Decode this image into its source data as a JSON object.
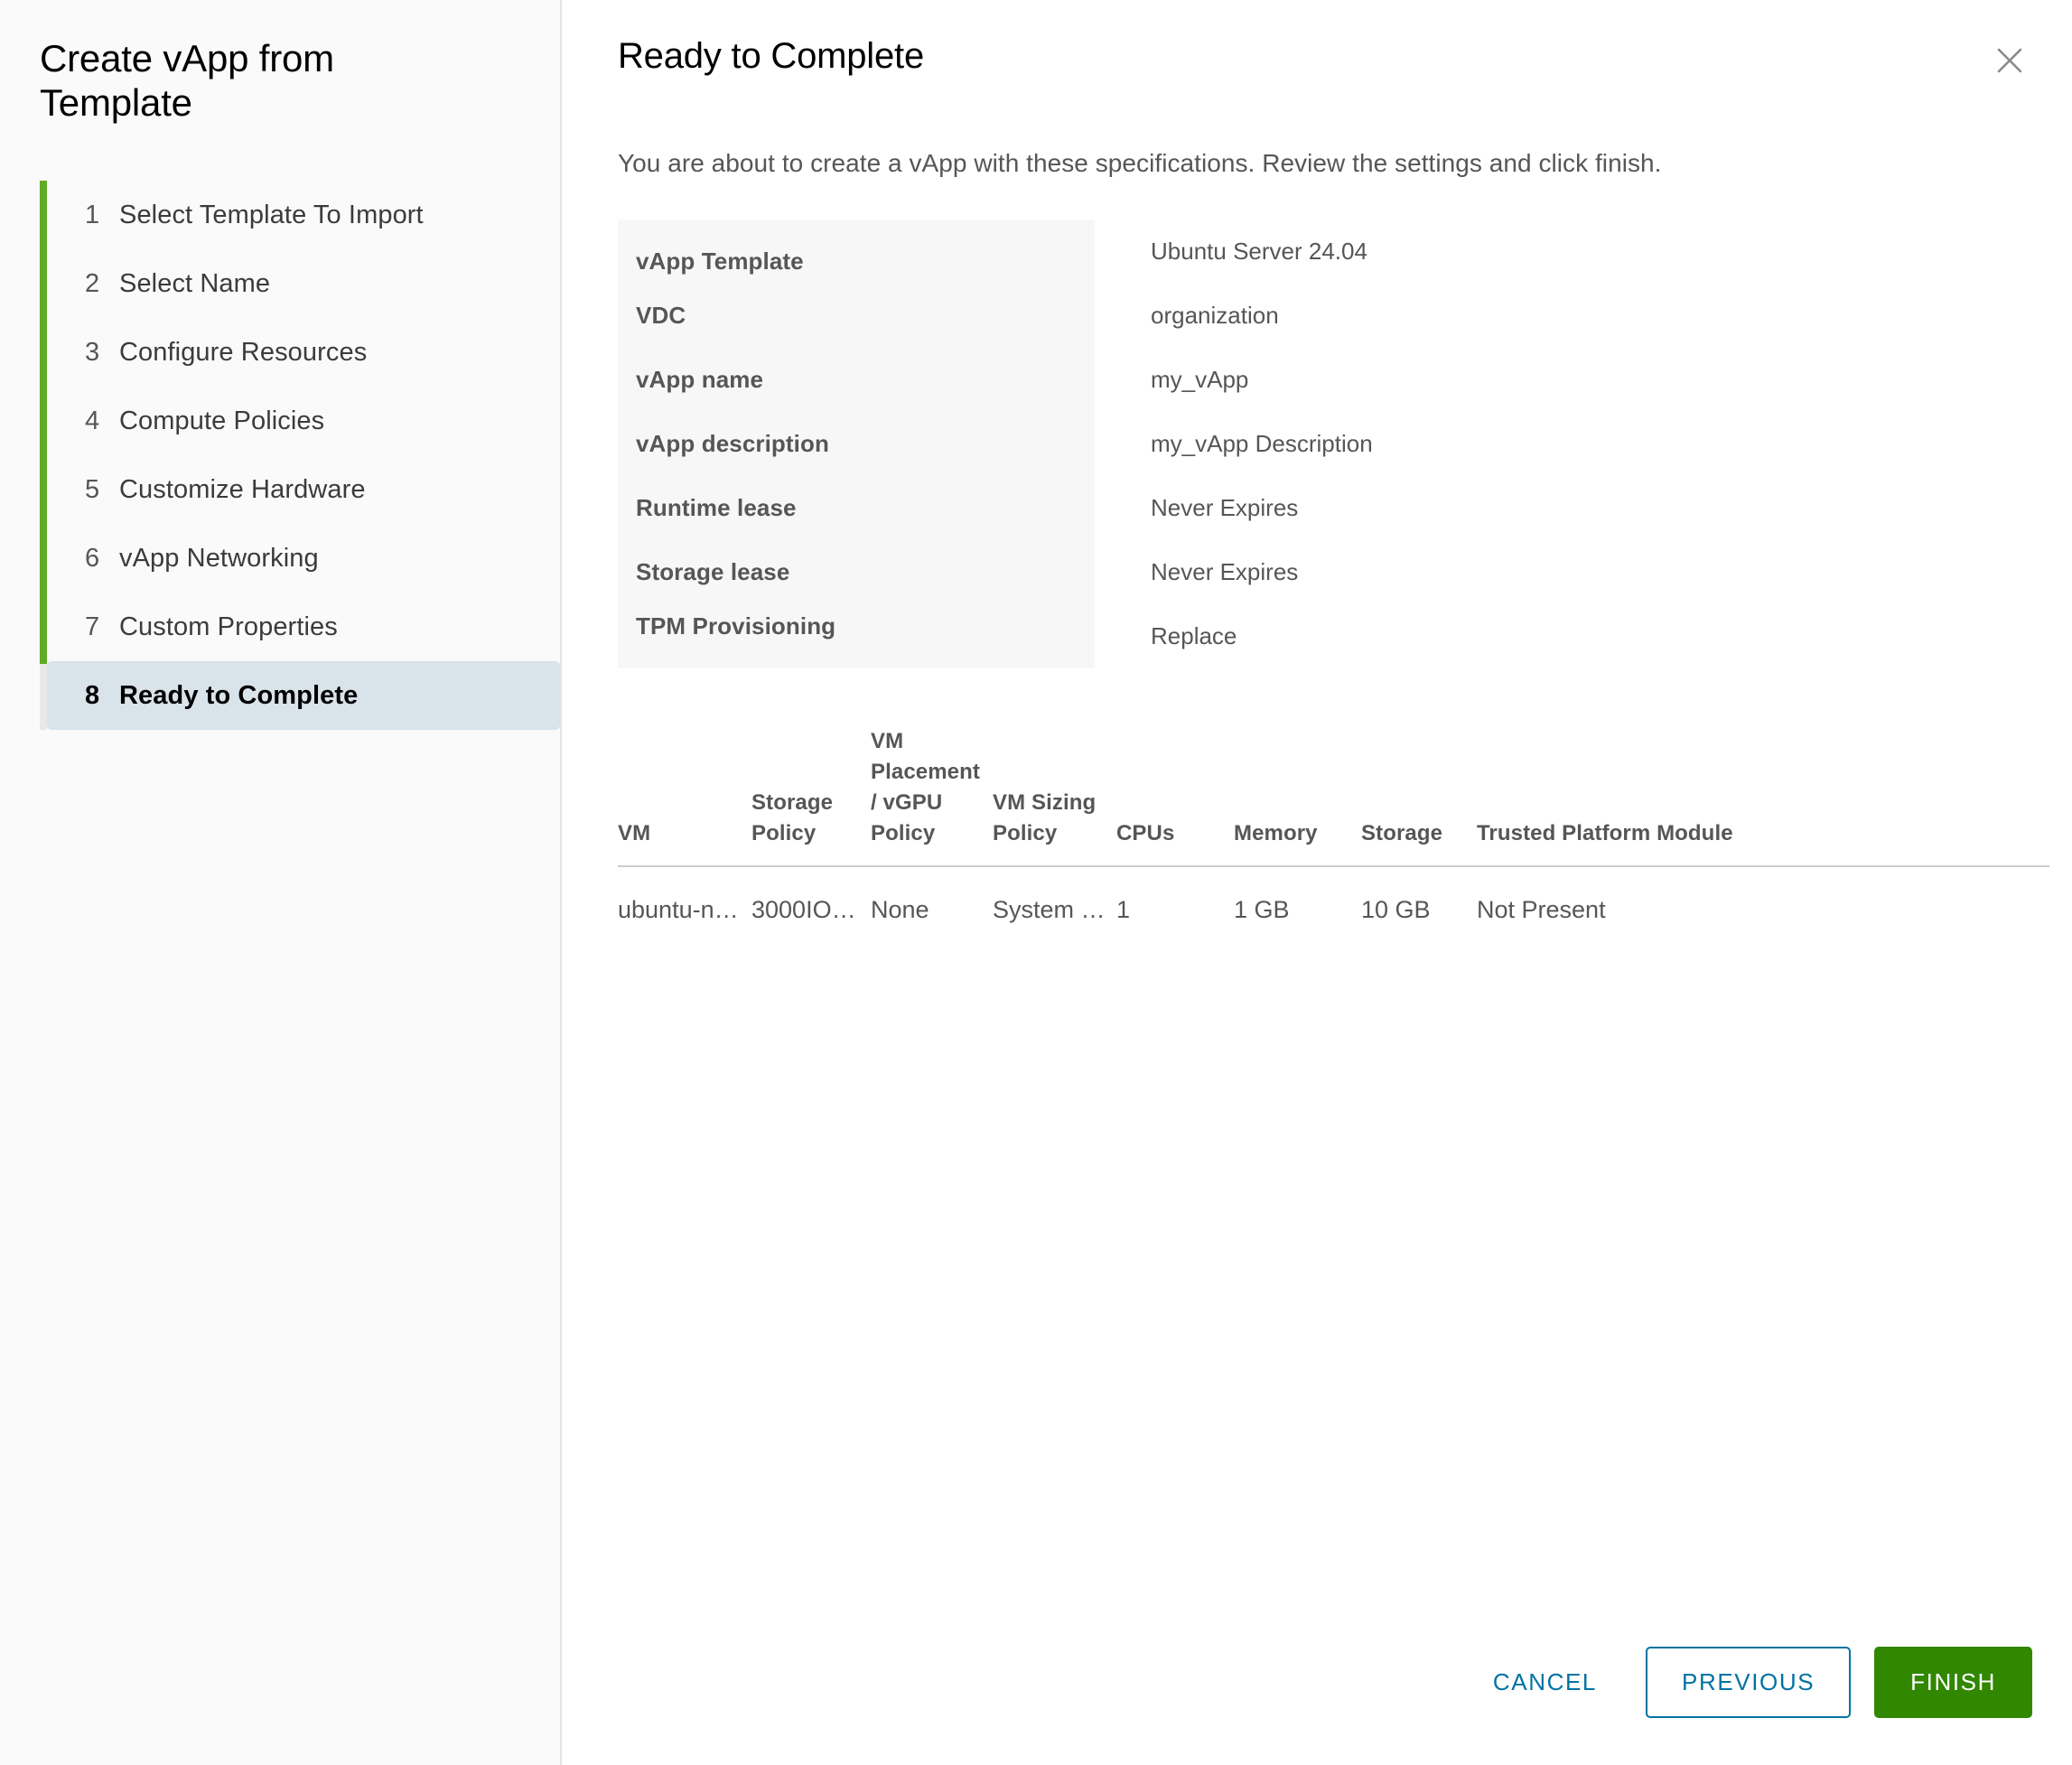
{
  "wizard": {
    "title": "Create vApp from Template",
    "steps": [
      {
        "num": "1",
        "label": "Select Template To Import",
        "active": false
      },
      {
        "num": "2",
        "label": "Select Name",
        "active": false
      },
      {
        "num": "3",
        "label": "Configure Resources",
        "active": false
      },
      {
        "num": "4",
        "label": "Compute Policies",
        "active": false
      },
      {
        "num": "5",
        "label": "Customize Hardware",
        "active": false
      },
      {
        "num": "6",
        "label": "vApp Networking",
        "active": false
      },
      {
        "num": "7",
        "label": "Custom Properties",
        "active": false
      },
      {
        "num": "8",
        "label": "Ready to Complete",
        "active": true
      }
    ],
    "progress_fill_percent": 88,
    "accent_green": "#5faa27",
    "active_step_bg": "#d8e3ea"
  },
  "header": {
    "title": "Ready to Complete",
    "close_icon": "close-icon"
  },
  "main": {
    "intro": "You are about to create a vApp with these specifications. Review the settings and click finish."
  },
  "spec": {
    "rows": [
      {
        "label": "vApp Template",
        "value": "Ubuntu Server 24.04"
      },
      {
        "label": "VDC",
        "value": "organization"
      },
      {
        "label": "vApp name",
        "value": "my_vApp"
      },
      {
        "label": "vApp description",
        "value": "my_vApp Description"
      },
      {
        "label": "Runtime lease",
        "value": "Never Expires"
      },
      {
        "label": "Storage lease",
        "value": "Never Expires"
      },
      {
        "label": "TPM Provisioning",
        "value": "Replace"
      }
    ]
  },
  "vm_table": {
    "columns": [
      "VM",
      "Storage Policy",
      "VM Placement / vGPU Policy",
      "VM Sizing Policy",
      "CPUs",
      "Memory",
      "Storage",
      "Trusted Platform Module"
    ],
    "rows": [
      {
        "vm": "ubuntu-nobl…",
        "storage_policy": "3000IOPS …",
        "placement_policy": "None",
        "sizing_policy": "System De…",
        "cpus": "1",
        "memory": "1 GB",
        "storage": "10 GB",
        "tpm": "Not Present"
      }
    ]
  },
  "footer": {
    "cancel_label": "CANCEL",
    "previous_label": "PREVIOUS",
    "finish_label": "FINISH",
    "link_color": "#0072a3",
    "primary_color": "#318700"
  }
}
